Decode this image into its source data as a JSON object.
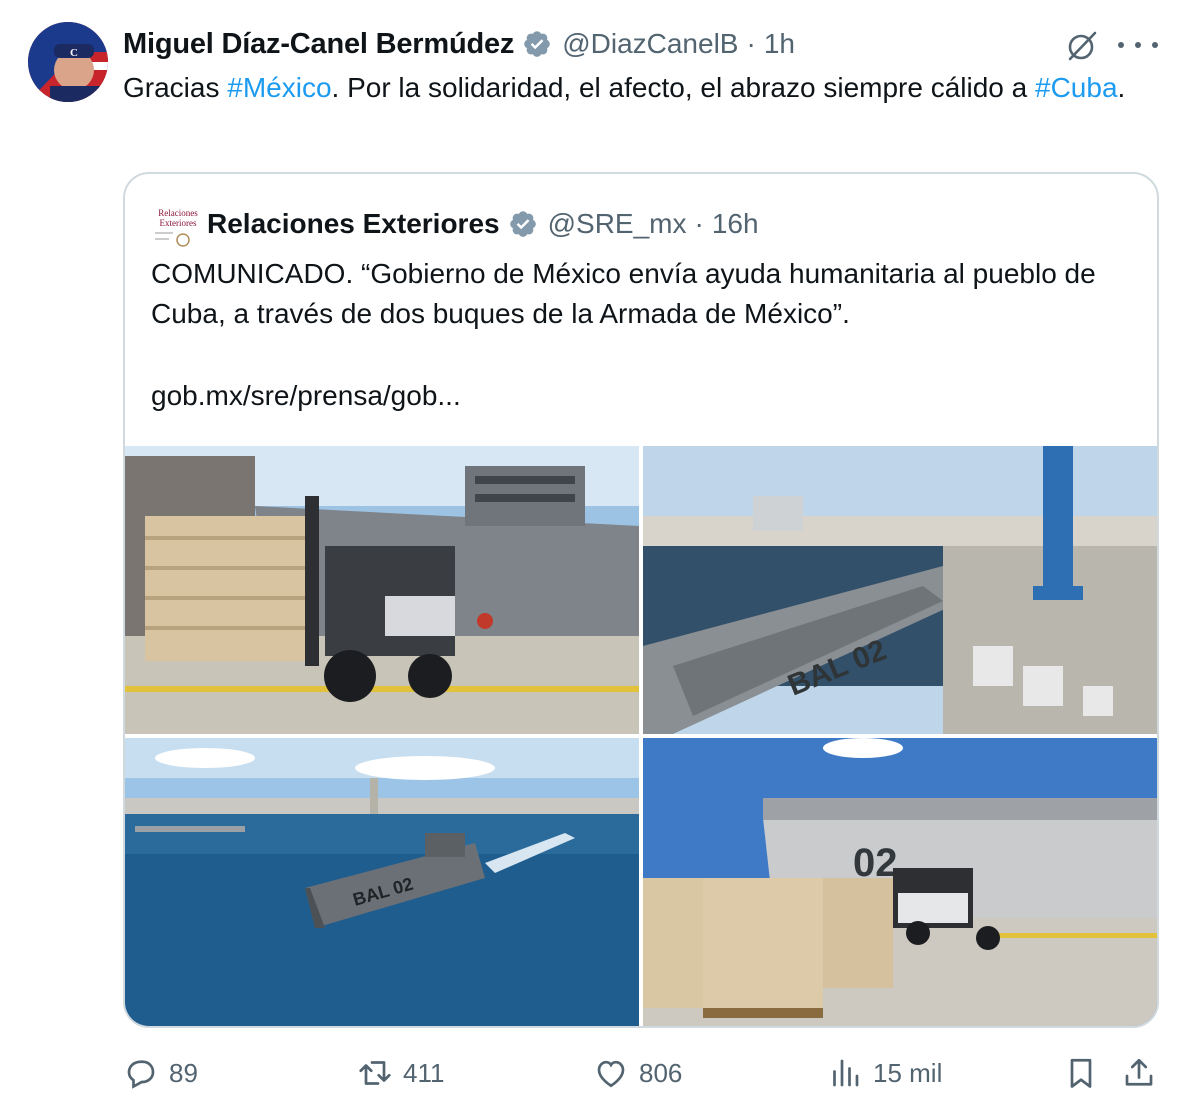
{
  "tweet": {
    "author_name": "Miguel Díaz-Canel Bermúdez",
    "handle": "@DiazCanelB",
    "separator": "·",
    "time": "1h",
    "text_1": "Gracias ",
    "hashtag_1": "#México",
    "text_2": ". Por la solidaridad,  el afecto, el abrazo siempre cálido a ",
    "hashtag_2": "#Cuba",
    "text_3": "."
  },
  "quote": {
    "author_name": "Relaciones Exteriores",
    "handle": "@SRE_mx",
    "separator": "·",
    "time": "16h",
    "text": "COMUNICADO. “Gobierno de México envía ayuda humanitaria al pueblo de Cuba, a través de dos buques de la Armada de México”.",
    "link": "gob.mx/sre/prensa/gob...",
    "avatar_logo_text": "Relaciones Exteriores",
    "photos": [
      {
        "alt": "Forklift carrying pallet of sacks next to navy ship at dock"
      },
      {
        "alt": "Aerial view of navy ship BAL 02 at port with cargo pallets"
      },
      {
        "alt": "Navy ship BAL 02 sailing in bay with city skyline"
      },
      {
        "alt": "Pallets of sacks and forklift beside ship hull BAL 02"
      }
    ],
    "ship_label": "BAL 02"
  },
  "actions": {
    "replies": "89",
    "reposts": "411",
    "likes": "806",
    "views": "15 mil"
  },
  "colors": {
    "accent": "#1d9bf0",
    "verified_badge": "#829aab",
    "muted": "#536471",
    "border": "#cfd9de"
  }
}
